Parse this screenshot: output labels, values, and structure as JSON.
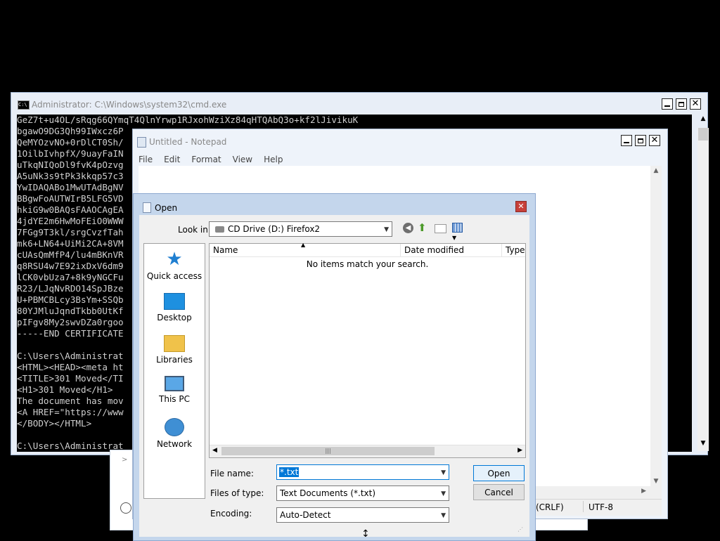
{
  "cmd": {
    "title": "Administrator: C:\\Windows\\system32\\cmd.exe",
    "lines": [
      "GeZ7t+u4OL/sRqg66QYmqT4QlnYrwp1RJxohWziXz84qHTQAbQ3o+kf2lJivikuK",
      "bgawO9DG3Qh99IWxcz6P",
      "QeMYOzvNO+0rDlCT0Sh/",
      "1OilbIvhpfX/9uayFaIN",
      "uTkqNIQoDl9fvK4pOzvg",
      "A5uNk3s9tPk3kkqp57c3",
      "YwIDAQABo1MwUTAdBgNV",
      "BBgwFoAUTWIrB5LFG5VD",
      "hkiG9w0BAQsFAAOCAgEA",
      "4jdYE2m6HwMoFEiO0WWW",
      "7FGg9T3kl/srgCvzfTah",
      "mk6+LN64+UiMi2CA+8VM",
      "cUAsQmMfP4/lu4mBKnVR",
      "q8RSU4w7E92ixDxV6dm9",
      "lCK0vbUza7+8k9yNGCFu",
      "R23/LJqNvRDO14SpJBze",
      "U+PBMCBLcy3BsYm+SSQb",
      "80YJMluJqndTkbb0UtKf",
      "pIFgv8My2swvDZa0rgoo",
      "-----END CERTIFICATE",
      "",
      "C:\\Users\\Administrat",
      "<HTML><HEAD><meta ht",
      "<TITLE>301 Moved</TI",
      "<H1>301 Moved</H1>",
      "The document has mov",
      "<A HREF=\"https://www",
      "</BODY></HTML>",
      "",
      "C:\\Users\\Administrat"
    ]
  },
  "notepad": {
    "title": "Untitled - Notepad",
    "menu": [
      "File",
      "Edit",
      "Format",
      "View",
      "Help"
    ],
    "status_line_ending": "(CRLF)",
    "status_encoding": "UTF-8"
  },
  "dialog": {
    "title": "Open",
    "look_in_label": "Look in:",
    "look_in_value": "CD Drive (D:) Firefox2",
    "nav": [
      "Quick access",
      "Desktop",
      "Libraries",
      "This PC",
      "Network"
    ],
    "columns": [
      "Name",
      "Date modified",
      "Type"
    ],
    "empty_message": "No items match your search.",
    "file_name_label": "File name:",
    "file_name_value": "*.txt",
    "files_of_type_label": "Files of type:",
    "files_of_type_value": "Text Documents (*.txt)",
    "encoding_label": "Encoding:",
    "encoding_value": "Auto-Detect",
    "open_button": "Open",
    "cancel_button": "Cancel"
  },
  "colors": {
    "dialog_frame": "#c4d6ec",
    "close_red": "#c7403a",
    "selection_blue": "#0078d7"
  }
}
